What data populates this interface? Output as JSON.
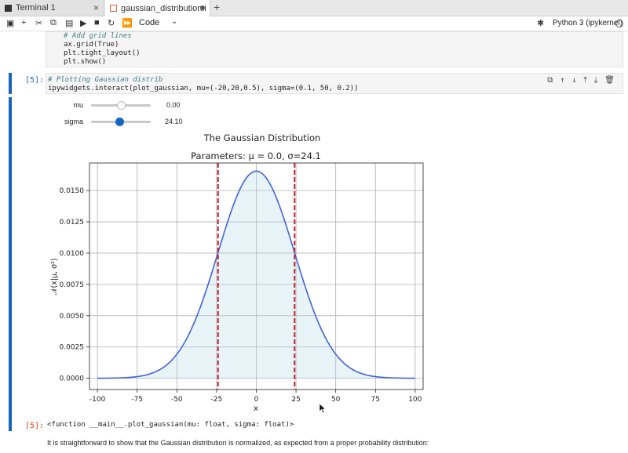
{
  "tabs": [
    {
      "label": "Terminal 1",
      "icon": "terminal-icon",
      "active": false
    },
    {
      "label": "gaussian_distribution.ipynb",
      "icon": "notebook-icon",
      "active": true
    }
  ],
  "toolbar": {
    "cell_type": "Code",
    "kernel": "Python 3 (ipykernel)"
  },
  "previous_cell": {
    "lines": [
      "# Add grid lines",
      "ax.grid(True)",
      "plt.tight_layout()",
      "plt.show()"
    ]
  },
  "current_cell": {
    "prompt": "[5]:",
    "comment": "# Plotting Gaussian distrib",
    "code": "ipywidgets.interact(plot_gaussian, mu=(-20,20,0.5), sigma=(0.1, 50, 0.2))"
  },
  "widgets": [
    {
      "label": "mu",
      "value": "0.00",
      "min": -20,
      "max": 20,
      "current": 0.0
    },
    {
      "label": "sigma",
      "value": "24.10",
      "min": 0.1,
      "max": 50,
      "current": 24.1
    }
  ],
  "output": {
    "prompt": "[5]:",
    "text": "<function __main__.plot_gaussian(mu: float, sigma: float)>"
  },
  "markdown": {
    "text": "It is straightforward to show that the Gaussian distribution is normalized, as expected from a proper probability distribution:"
  },
  "chart_data": {
    "type": "line",
    "suptitle": "The Gaussian Distribution",
    "title": "Parameters: μ = 0.0, σ=24.1",
    "xlabel": "x",
    "ylabel": "𝒩(x|μ, σ²)",
    "xlim": [
      -105,
      105
    ],
    "ylim": [
      -0.0009,
      0.0172
    ],
    "xticks": [
      -100,
      -75,
      -50,
      -25,
      0,
      25,
      50,
      75,
      100
    ],
    "yticks": [
      0.0,
      0.0025,
      0.005,
      0.0075,
      0.01,
      0.0125,
      0.015
    ],
    "ytick_labels": [
      "0.0000",
      "0.0025",
      "0.0050",
      "0.0075",
      "0.0100",
      "0.0125",
      "0.0150"
    ],
    "grid": true,
    "series": [
      {
        "mu": 0.0,
        "sigma": 24.1,
        "x_range": [
          -100,
          100
        ],
        "color": "#4063d8"
      }
    ],
    "vlines": [
      {
        "x": -24.1,
        "color": "#c8202a",
        "style": "dashed"
      },
      {
        "x": 24.1,
        "color": "#c8202a",
        "style": "dashed"
      }
    ],
    "fill_color": "#add8e6"
  }
}
